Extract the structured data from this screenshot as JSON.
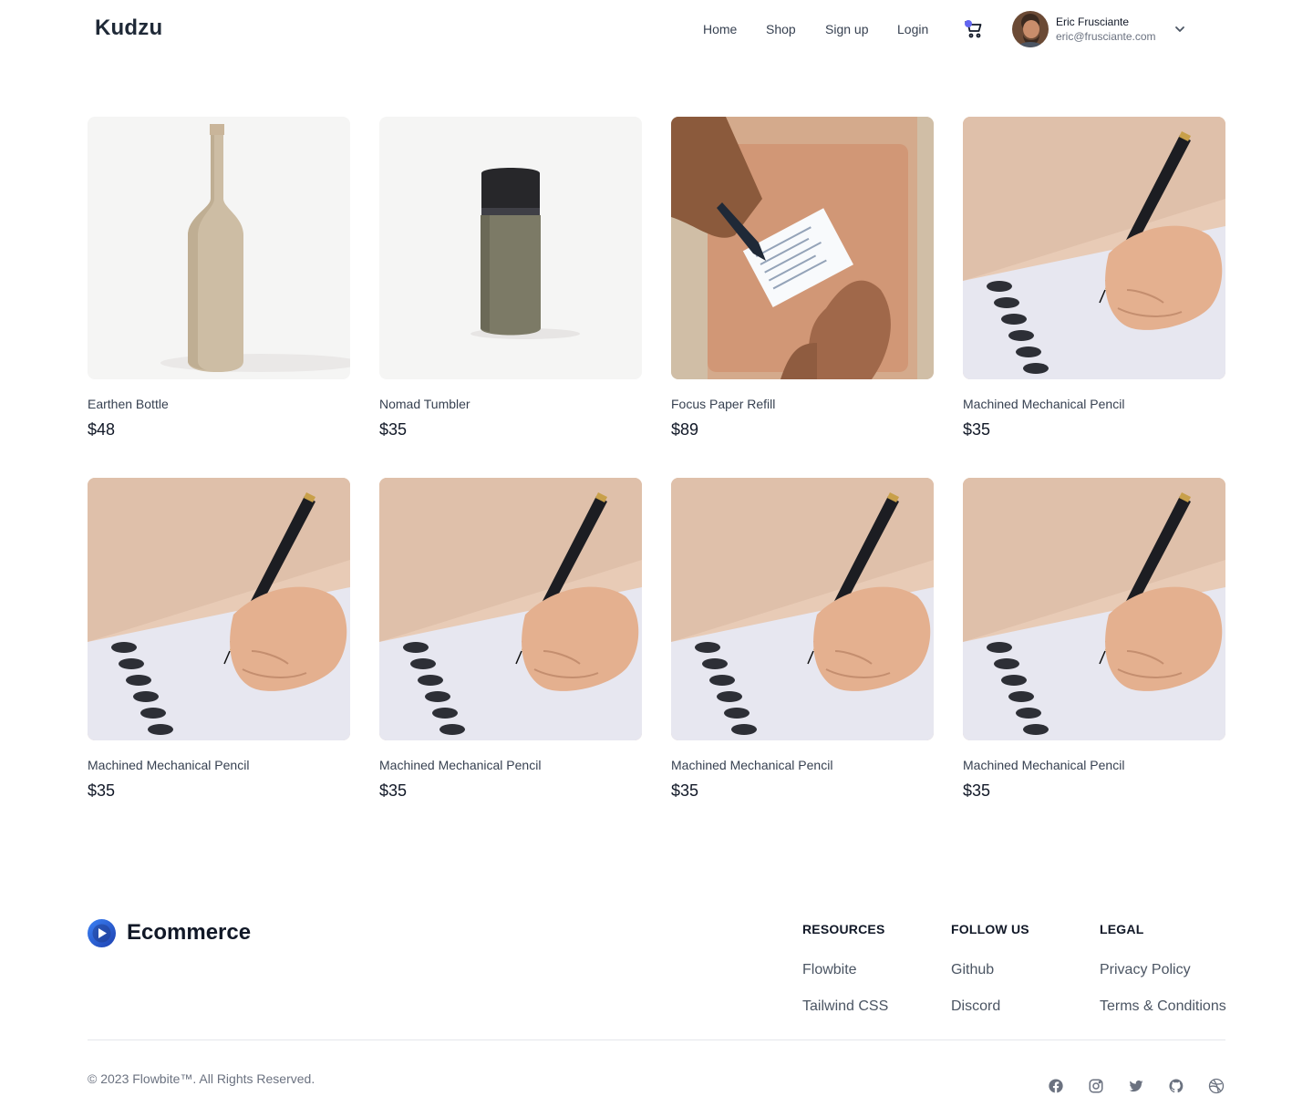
{
  "header": {
    "brand": "Kudzu",
    "nav": [
      {
        "label": "Home"
      },
      {
        "label": "Shop"
      },
      {
        "label": "Sign up"
      },
      {
        "label": "Login"
      }
    ],
    "cart_icon": "cart-icon",
    "notification_color": "#6366f1",
    "user": {
      "name": "Eric Frusciante",
      "email": "eric@frusciante.com"
    }
  },
  "products": [
    {
      "name": "Earthen Bottle",
      "price": "$48",
      "image": "bottle"
    },
    {
      "name": "Nomad Tumbler",
      "price": "$35",
      "image": "tumbler"
    },
    {
      "name": "Focus Paper Refill",
      "price": "$89",
      "image": "paper"
    },
    {
      "name": "Machined Mechanical Pencil",
      "price": "$35",
      "image": "pencil"
    },
    {
      "name": "Machined Mechanical Pencil",
      "price": "$35",
      "image": "pencil"
    },
    {
      "name": "Machined Mechanical Pencil",
      "price": "$35",
      "image": "pencil"
    },
    {
      "name": "Machined Mechanical Pencil",
      "price": "$35",
      "image": "pencil"
    },
    {
      "name": "Machined Mechanical Pencil",
      "price": "$35",
      "image": "pencil"
    }
  ],
  "footer": {
    "brand": "Ecommerce",
    "columns": [
      {
        "heading": "RESOURCES",
        "links": [
          "Flowbite",
          "Tailwind CSS"
        ]
      },
      {
        "heading": "FOLLOW US",
        "links": [
          "Github",
          "Discord"
        ]
      },
      {
        "heading": "LEGAL",
        "links": [
          "Privacy Policy",
          "Terms & Conditions"
        ]
      }
    ],
    "copyright": "© 2023 Flowbite™. All Rights Reserved.",
    "social_icons": [
      "facebook-icon",
      "instagram-icon",
      "twitter-icon",
      "github-icon",
      "dribbble-icon"
    ]
  },
  "colors": {
    "accent": "#1d4ed8",
    "text": "#111827",
    "muted": "#6b7280"
  }
}
